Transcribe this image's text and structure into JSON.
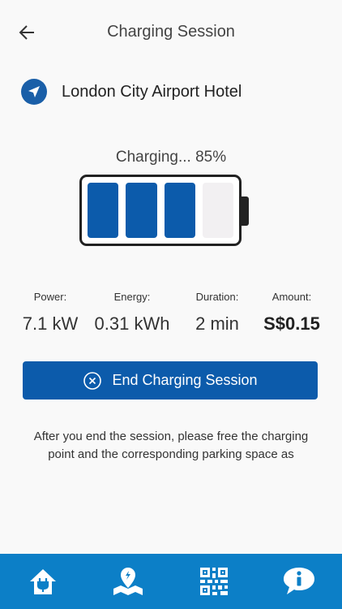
{
  "header": {
    "title": "Charging Session"
  },
  "location": {
    "name": "London City Airport Hotel"
  },
  "status": {
    "text": "Charging... 85%",
    "percent": 85,
    "filled_bars": 3,
    "total_bars": 4
  },
  "stats": {
    "power": {
      "label": "Power:",
      "value": "7.1 kW"
    },
    "energy": {
      "label": "Energy:",
      "value": "0.31 kWh"
    },
    "duration": {
      "label": "Duration:",
      "value": "2 min"
    },
    "amount": {
      "label": "Amount:",
      "value": "S$0.15"
    }
  },
  "end_button": {
    "label": "End Charging Session"
  },
  "note": {
    "line1": "After you end the session, please free the charging",
    "line2": "point and the corresponding parking space as"
  },
  "tabs": [
    {
      "icon": "home-plug-icon"
    },
    {
      "icon": "map-pin-icon"
    },
    {
      "icon": "qr-code-icon"
    },
    {
      "icon": "info-icon"
    }
  ],
  "colors": {
    "primary": "#0c5bab",
    "tabbar": "#0c7fc7",
    "background": "#f9f9f9"
  }
}
